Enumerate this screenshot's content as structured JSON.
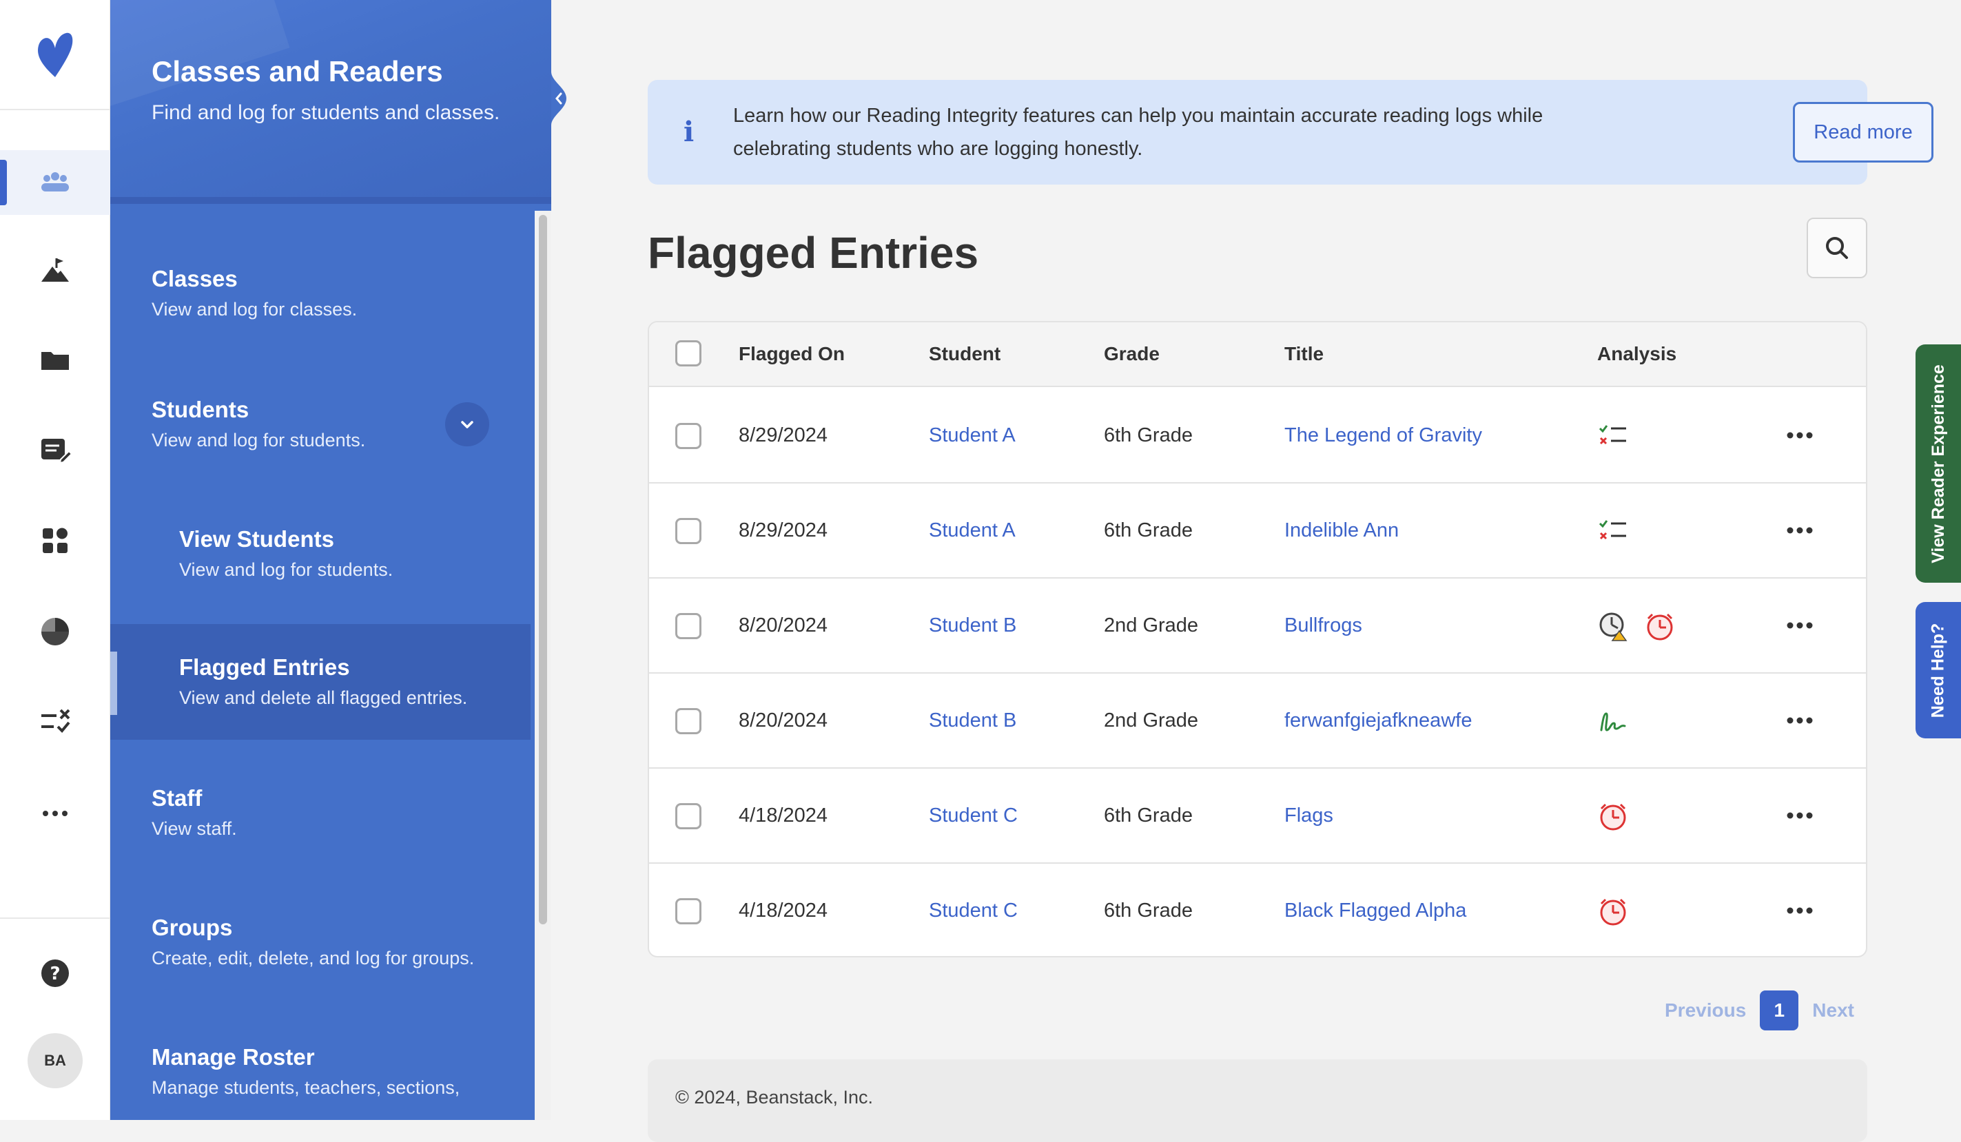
{
  "colors": {
    "accent": "#3c63c9",
    "panel": "#4470c9",
    "panel_active": "#3a60b5",
    "green_tab": "#2f6b3e"
  },
  "rail": {
    "items": [
      {
        "icon": "users-icon",
        "active": true
      },
      {
        "icon": "mountain-flag-icon",
        "active": false
      },
      {
        "icon": "folder-icon",
        "active": false
      },
      {
        "icon": "log-edit-icon",
        "active": false
      },
      {
        "icon": "grid-icon",
        "active": false
      },
      {
        "icon": "pie-chart-icon",
        "active": false
      },
      {
        "icon": "checklist-icon",
        "active": false
      },
      {
        "icon": "more-icon",
        "active": false
      }
    ],
    "help_icon": "help-icon",
    "avatar_initials": "BA"
  },
  "panel": {
    "title": "Classes and Readers",
    "subtitle": "Find and log for students and classes.",
    "nav": [
      {
        "key": "classes",
        "title": "Classes",
        "desc": "View and log for classes."
      },
      {
        "key": "students",
        "title": "Students",
        "desc": "View and log for students."
      },
      {
        "key": "view_students",
        "title": "View Students",
        "desc": "View and log for students."
      },
      {
        "key": "flagged",
        "title": "Flagged Entries",
        "desc": "View and delete all flagged entries.",
        "active": true
      },
      {
        "key": "staff",
        "title": "Staff",
        "desc": "View staff."
      },
      {
        "key": "groups",
        "title": "Groups",
        "desc": "Create, edit, delete, and log for groups."
      },
      {
        "key": "roster",
        "title": "Manage Roster",
        "desc": "Manage students, teachers, sections,"
      }
    ]
  },
  "banner": {
    "text": "Learn how our Reading Integrity features can help you maintain accurate reading logs while celebrating students who are logging honestly.",
    "button": "Read more"
  },
  "page": {
    "title": "Flagged Entries"
  },
  "table": {
    "columns": [
      "Flagged On",
      "Student",
      "Grade",
      "Title",
      "Analysis"
    ],
    "rows": [
      {
        "date": "8/29/2024",
        "student": "Student A",
        "grade": "6th Grade",
        "title": "The Legend of Gravity",
        "analysis": [
          "checklist-flag-icon"
        ]
      },
      {
        "date": "8/29/2024",
        "student": "Student A",
        "grade": "6th Grade",
        "title": "Indelible Ann",
        "analysis": [
          "checklist-flag-icon"
        ]
      },
      {
        "date": "8/20/2024",
        "student": "Student B",
        "grade": "2nd Grade",
        "title": "Bullfrogs",
        "analysis": [
          "clock-warning-icon",
          "alarm-clock-icon"
        ]
      },
      {
        "date": "8/20/2024",
        "student": "Student B",
        "grade": "2nd Grade",
        "title": "ferwanfgiejafkneawfe",
        "analysis": [
          "signature-icon"
        ]
      },
      {
        "date": "4/18/2024",
        "student": "Student C",
        "grade": "6th Grade",
        "title": "Flags",
        "analysis": [
          "alarm-clock-icon"
        ]
      },
      {
        "date": "4/18/2024",
        "student": "Student C",
        "grade": "6th Grade",
        "title": "Black Flagged Alpha",
        "analysis": [
          "alarm-clock-icon"
        ]
      }
    ]
  },
  "pagination": {
    "previous": "Previous",
    "current": "1",
    "next": "Next"
  },
  "footer": {
    "text": "© 2024, Beanstack, Inc."
  },
  "side_tabs": {
    "reader": "View Reader Experience",
    "help": "Need Help?"
  }
}
